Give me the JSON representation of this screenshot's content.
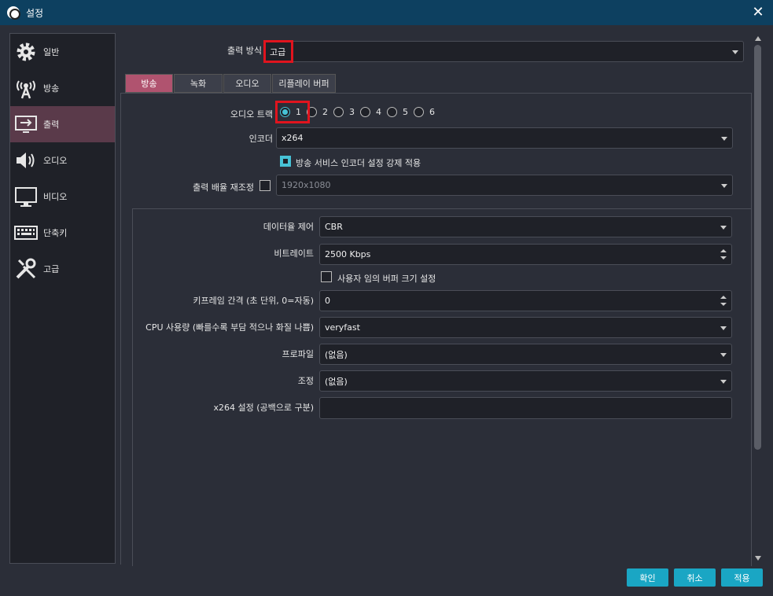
{
  "window": {
    "title": "설정"
  },
  "sidebar": {
    "items": [
      {
        "label": "일반",
        "icon": "gear-icon"
      },
      {
        "label": "방송",
        "icon": "broadcast-tower-icon"
      },
      {
        "label": "출력",
        "icon": "output-monitor-icon",
        "active": true
      },
      {
        "label": "오디오",
        "icon": "speaker-icon"
      },
      {
        "label": "비디오",
        "icon": "display-icon"
      },
      {
        "label": "단축키",
        "icon": "keyboard-icon"
      },
      {
        "label": "고급",
        "icon": "tools-icon"
      }
    ]
  },
  "output_mode": {
    "label": "출력 방식",
    "value": "고급"
  },
  "tabs": [
    "방송",
    "녹화",
    "오디오",
    "리플레이 버퍼"
  ],
  "audio_track": {
    "label": "오디오 트랙",
    "options": [
      "1",
      "2",
      "3",
      "4",
      "5",
      "6"
    ],
    "selected": "1"
  },
  "encoder": {
    "label": "인코더",
    "value": "x264"
  },
  "enforce": {
    "label": "방송 서비스 인코더 설정 강제 적용",
    "checked": true
  },
  "rescale": {
    "label": "출력 배율 재조정",
    "value": "1920x1080",
    "checked": false
  },
  "encoder_settings": {
    "rate_control": {
      "label": "데이터율 제어",
      "value": "CBR"
    },
    "bitrate": {
      "label": "비트레이트",
      "value": "2500 Kbps"
    },
    "custom_buffer": {
      "label": "사용자 임의 버퍼 크기 설정",
      "checked": false
    },
    "keyframe": {
      "label": "키프레임 간격 (초 단위, 0=자동)",
      "value": "0"
    },
    "cpu_preset": {
      "label": "CPU 사용량 (빠를수록 부담 적으나 화질 나쁨)",
      "value": "veryfast"
    },
    "profile": {
      "label": "프로파일",
      "value": "(없음)"
    },
    "tune": {
      "label": "조정",
      "value": "(없음)"
    },
    "x264_opts": {
      "label": "x264 설정 (공백으로 구분)",
      "value": ""
    }
  },
  "buttons": {
    "ok": "확인",
    "cancel": "취소",
    "apply": "적용"
  },
  "colors": {
    "accent": "#1aa6c4",
    "active_tab": "#b0536f",
    "highlight": "#e0141e"
  }
}
